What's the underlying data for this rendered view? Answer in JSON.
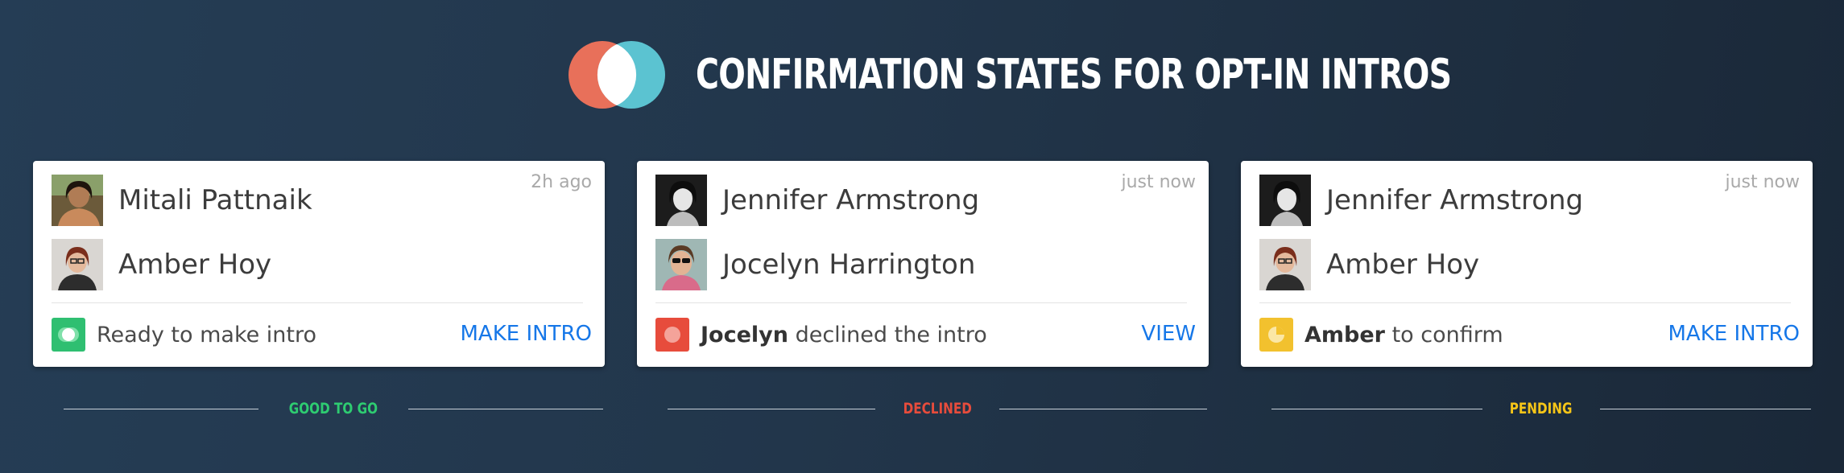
{
  "header": {
    "title": "CONFIRMATION STATES FOR OPT-IN INTROS",
    "logo_icon": "overlapping-circles-icon",
    "logo_colors": [
      "#e8705a",
      "#5bc3d1"
    ]
  },
  "cards": [
    {
      "time": "2h ago",
      "person1": "Mitali Pattnaik",
      "person2": "Amber Hoy",
      "status_icon": "toggle-on-icon",
      "status_color": "#2fbf71",
      "status_bold": "",
      "status_text": "Ready to make intro",
      "action": "MAKE INTRO",
      "state_label": "GOOD TO GO",
      "state_color": "#2ecc71"
    },
    {
      "time": "just now",
      "person1": "Jennifer Armstrong",
      "person2": "Jocelyn Harrington",
      "status_icon": "declined-dot-icon",
      "status_color": "#e74c3c",
      "status_bold": "Jocelyn",
      "status_text": " declined the intro",
      "action": "VIEW",
      "state_label": "DECLINED",
      "state_color": "#e74c3c"
    },
    {
      "time": "just now",
      "person1": "Jennifer Armstrong",
      "person2": "Amber Hoy",
      "status_icon": "pending-pie-icon",
      "status_color": "#f2c12e",
      "status_bold": "Amber",
      "status_text": " to confirm",
      "action": "MAKE INTRO",
      "state_label": "PENDING",
      "state_color": "#f5c518"
    }
  ]
}
